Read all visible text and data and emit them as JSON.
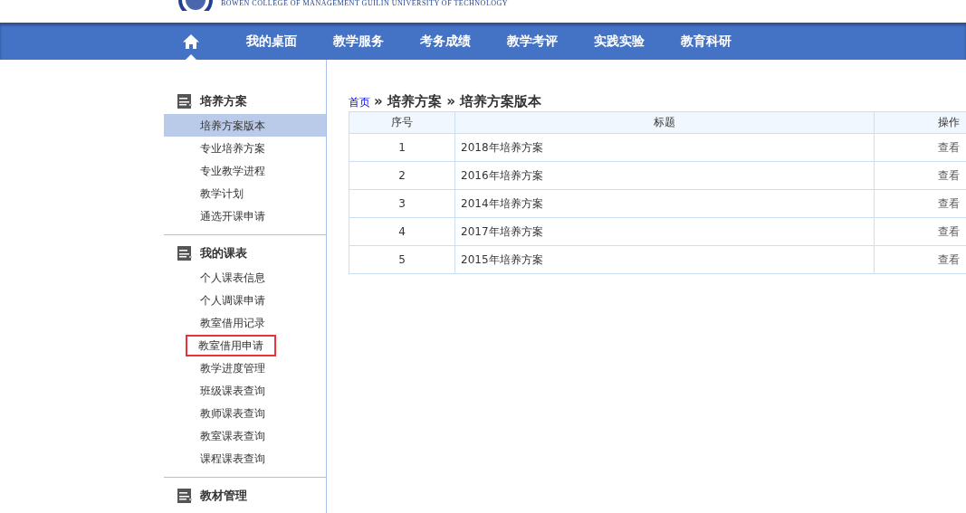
{
  "header": {
    "subtitle": "BOWEN COLLEGE OF MANAGEMENT GUILIN UNIVERSITY OF TECHNOLOGY"
  },
  "nav": {
    "items": [
      {
        "kind": "home",
        "selected": true
      },
      {
        "kind": "text",
        "label": "我的桌面",
        "selected": false
      },
      {
        "kind": "text",
        "label": "教学服务",
        "selected": false
      },
      {
        "kind": "text",
        "label": "考务成绩",
        "selected": false
      },
      {
        "kind": "text",
        "label": "教学考评",
        "selected": false
      },
      {
        "kind": "text",
        "label": "实践实验",
        "selected": false
      },
      {
        "kind": "text",
        "label": "教育科研",
        "selected": false
      }
    ]
  },
  "sidebar": {
    "sections": [
      {
        "title": "培养方案",
        "items": [
          {
            "label": "培养方案版本",
            "selected": true,
            "highlighted": false
          },
          {
            "label": "专业培养方案",
            "selected": false,
            "highlighted": false
          },
          {
            "label": "专业教学进程",
            "selected": false,
            "highlighted": false
          },
          {
            "label": "教学计划",
            "selected": false,
            "highlighted": false
          },
          {
            "label": "通选开课申请",
            "selected": false,
            "highlighted": false
          }
        ]
      },
      {
        "title": "我的课表",
        "items": [
          {
            "label": "个人课表信息",
            "selected": false,
            "highlighted": false
          },
          {
            "label": "个人调课申请",
            "selected": false,
            "highlighted": false
          },
          {
            "label": "教室借用记录",
            "selected": false,
            "highlighted": false
          },
          {
            "label": "教室借用申请",
            "selected": false,
            "highlighted": true
          },
          {
            "label": "教学进度管理",
            "selected": false,
            "highlighted": false
          },
          {
            "label": "班级课表查询",
            "selected": false,
            "highlighted": false
          },
          {
            "label": "教师课表查询",
            "selected": false,
            "highlighted": false
          },
          {
            "label": "教室课表查询",
            "selected": false,
            "highlighted": false
          },
          {
            "label": "课程课表查询",
            "selected": false,
            "highlighted": false
          }
        ]
      },
      {
        "title": "教材管理"
      }
    ]
  },
  "breadcrumb": {
    "link": "首页",
    "parts": [
      "» 培养方案 » 培养方案版本"
    ]
  },
  "table": {
    "columns": [
      "序号",
      "标题",
      "操作"
    ],
    "rows": [
      [
        "1",
        "2018年培养方案",
        "查看"
      ],
      [
        "2",
        "2016年培养方案",
        "查看"
      ],
      [
        "3",
        "2014年培养方案",
        "查看"
      ],
      [
        "4",
        "2017年培养方案",
        "查看"
      ],
      [
        "5",
        "2015年培养方案",
        "查看"
      ]
    ]
  }
}
